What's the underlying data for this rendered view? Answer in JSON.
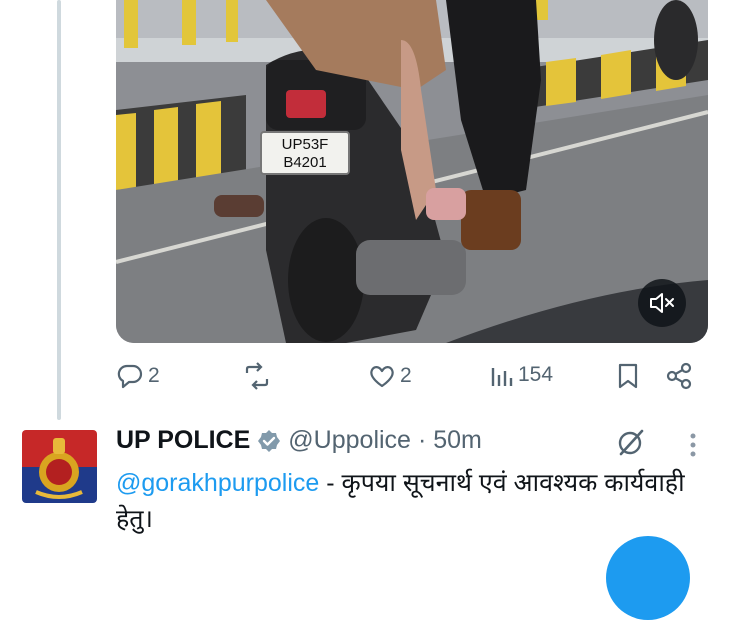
{
  "tweet_actions": {
    "replies": "2",
    "likes": "2",
    "views": "154"
  },
  "video": {
    "plate_line1": "UP53F",
    "plate_line2": "B4201",
    "mute_icon": "speaker-muted-icon"
  },
  "reply": {
    "name": "UP POLICE",
    "handle": "@Uppolice",
    "time": "· 50m",
    "mention": "@gorakhpurpolice",
    "text": " - कृपया सूचनार्थ एवं आवश्यक कार्यवाही हेतु।"
  },
  "colors": {
    "accent": "#1d9bf0",
    "verified": "#829aab",
    "muted_text": "#536471"
  }
}
